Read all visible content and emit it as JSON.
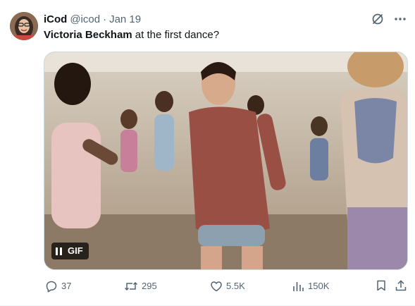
{
  "tweet": {
    "author_name": "iCod",
    "handle": "@icod",
    "separator": "·",
    "date": "Jan 19",
    "text_bold": "Victoria Beckham",
    "text_rest": " at the first dance?"
  },
  "media": {
    "badge_label": "GIF"
  },
  "actions": {
    "replies": "37",
    "reposts": "295",
    "likes": "5.5K",
    "views": "150K"
  },
  "icons": {
    "grok": "grok-icon",
    "more": "more-icon",
    "reply": "reply-icon",
    "repost": "repost-icon",
    "like": "heart-icon",
    "views": "views-icon",
    "bookmark": "bookmark-icon",
    "share": "share-icon",
    "pause": "pause-icon"
  },
  "colors": {
    "text": "#0f1419",
    "secondary": "#536471",
    "border": "#cfd9de"
  }
}
